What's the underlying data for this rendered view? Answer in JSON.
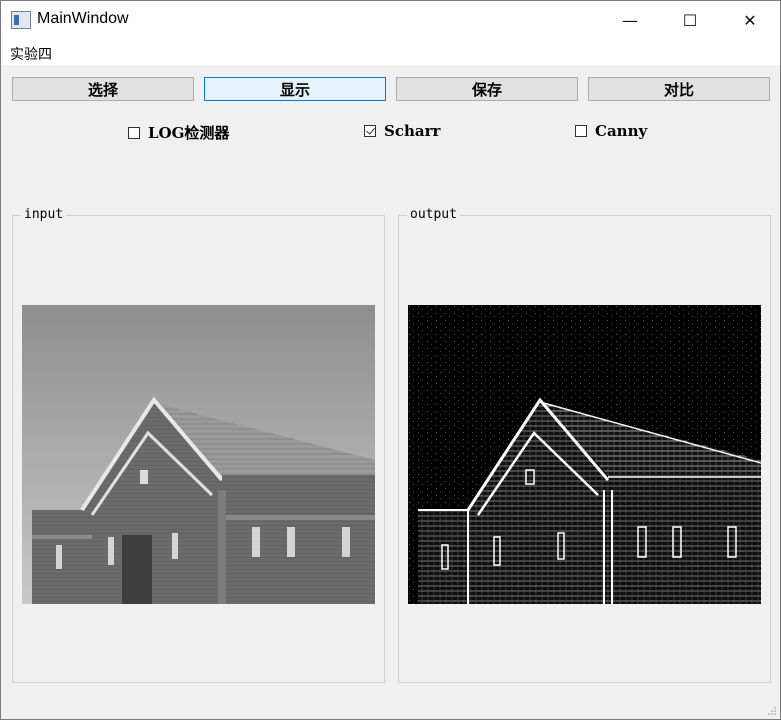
{
  "window": {
    "title": "MainWindow",
    "minimize": "—",
    "maximize": "☐",
    "close": "✕"
  },
  "menu": {
    "items": [
      "实验四"
    ]
  },
  "toolbar": {
    "buttons": [
      "选择",
      "显示",
      "保存",
      "对比"
    ],
    "active_index": 1
  },
  "options": [
    {
      "label": "LOG检测器",
      "checked": false
    },
    {
      "label": "Scharr",
      "checked": true
    },
    {
      "label": "Canny",
      "checked": false
    }
  ],
  "panels": {
    "input": {
      "title": "input"
    },
    "output": {
      "title": "output"
    }
  },
  "colors": {
    "accent": "#0078d7",
    "active_button_bg": "#e5f1fb",
    "window_bg": "#f0f0f0"
  }
}
